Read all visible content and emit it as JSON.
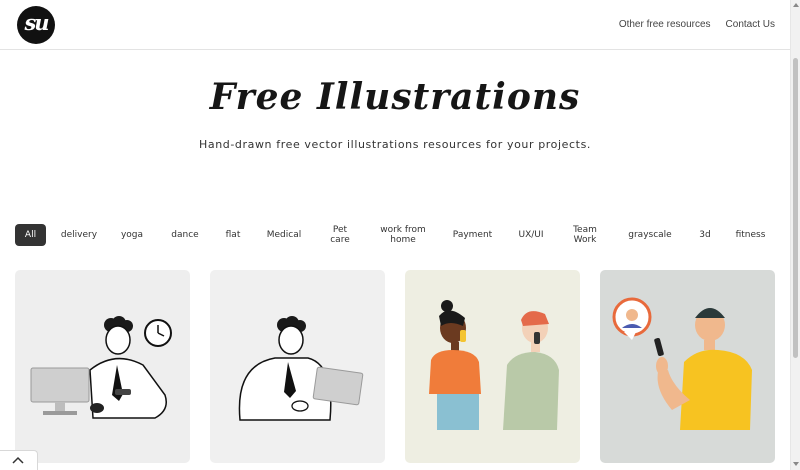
{
  "header": {
    "logo_text": "su",
    "nav": [
      {
        "label": "Other free resources"
      },
      {
        "label": "Contact Us"
      }
    ]
  },
  "hero": {
    "title": "Free Illustrations",
    "subtitle": "Hand-drawn free vector illustrations resources for your projects."
  },
  "filters": [
    {
      "label": "All",
      "active": true
    },
    {
      "label": "delivery"
    },
    {
      "label": "yoga"
    },
    {
      "label": "dance"
    },
    {
      "label": "flat"
    },
    {
      "label": "Medical"
    },
    {
      "label": "Pet care"
    },
    {
      "label": "work from home"
    },
    {
      "label": "Payment"
    },
    {
      "label": "UX/UI"
    },
    {
      "label": "Team Work"
    },
    {
      "label": "grayscale"
    },
    {
      "label": "3d"
    },
    {
      "label": "fitness"
    }
  ],
  "cards": [
    {
      "illustration": "man-at-desk-with-clock",
      "background": "#eeeeee"
    },
    {
      "illustration": "man-with-laptop-lineart",
      "background": "#f0f0f0"
    },
    {
      "illustration": "two-people-on-phone",
      "background": "#eeeee2"
    },
    {
      "illustration": "man-video-call-phone",
      "background": "#d7dad8"
    }
  ],
  "colors": {
    "accent_dark": "#333333",
    "text": "#222222"
  },
  "icons": {
    "back_to_top": "chevron-up-icon"
  }
}
